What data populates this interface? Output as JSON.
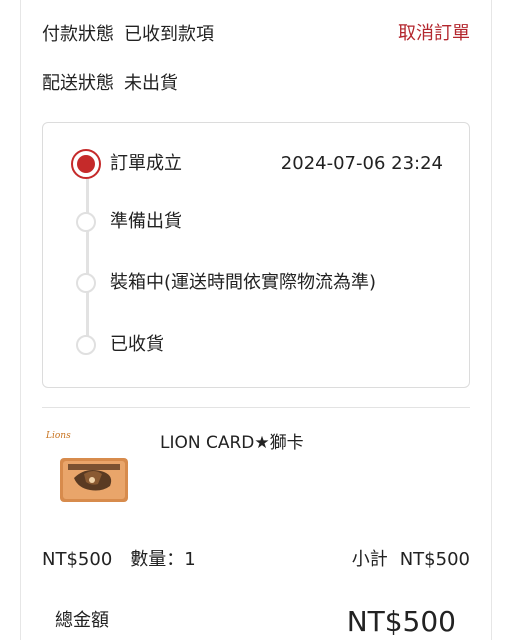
{
  "header": {
    "payment_label": "付款狀態",
    "payment_value": "已收到款項",
    "shipping_label": "配送狀態",
    "shipping_value": "未出貨",
    "cancel_label": "取消訂單"
  },
  "timeline": {
    "steps": [
      {
        "label": "訂單成立",
        "time": "2024-07-06 23:24",
        "active": true
      },
      {
        "label": "準備出貨",
        "time": "",
        "active": false
      },
      {
        "label": "裝箱中(運送時間依實際物流為準)",
        "time": "",
        "active": false
      },
      {
        "label": "已收貨",
        "time": "",
        "active": false
      }
    ]
  },
  "item": {
    "name": "LION CARD★獅卡",
    "price": "NT$500",
    "quantity_label": "數量：",
    "quantity": "1",
    "subtotal_label": "小計",
    "subtotal": "NT$500",
    "thumbnail_text": "Lions"
  },
  "summary": {
    "total_label": "總金額",
    "total": "NT$500"
  },
  "colors": {
    "accent": "#c52a2a",
    "cancel": "#b3262d"
  }
}
